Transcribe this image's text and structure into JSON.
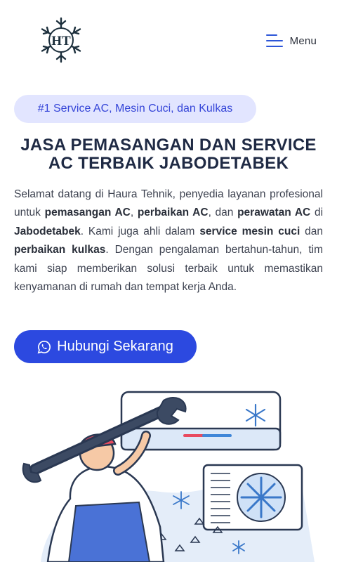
{
  "header": {
    "logo_text": "HT",
    "menu_label": "Menu"
  },
  "badge": {
    "text": "#1 Service AC, Mesin Cuci, dan Kulkas"
  },
  "hero": {
    "title_line1": "JASA PEMASANGAN DAN SERVICE",
    "title_line2": "AC TERBAIK JABODETABEK",
    "description": {
      "t1": "Selamat datang di Haura Tehnik, penyedia layanan profesional untuk ",
      "b1": "pemasangan AC",
      "t2": ", ",
      "b2": "perbaikan AC",
      "t3": ", dan ",
      "b3": "perawatan AC",
      "t4": " di ",
      "b4": "Jabodetabek",
      "t5": ". Kami juga ahli dalam ",
      "b5": "service mesin cuci",
      "t6": " dan ",
      "b6": "perbaikan kulkas",
      "t7": ". Dengan pengalaman bertahun-tahun, tim kami siap memberikan solusi terbaik untuk memastikan kenyamanan di rumah dan tempat kerja Anda."
    },
    "cta_label": "Hubungi Sekarang",
    "cta_icon": "whatsapp-icon",
    "illustration": "technician-with-wrench-and-ac-unit"
  },
  "colors": {
    "primary": "#2c49e0",
    "badge_bg": "#e2e5ff",
    "badge_text": "#3646d8",
    "title": "#1f2a44",
    "menu_icon": "#2d56d8"
  }
}
